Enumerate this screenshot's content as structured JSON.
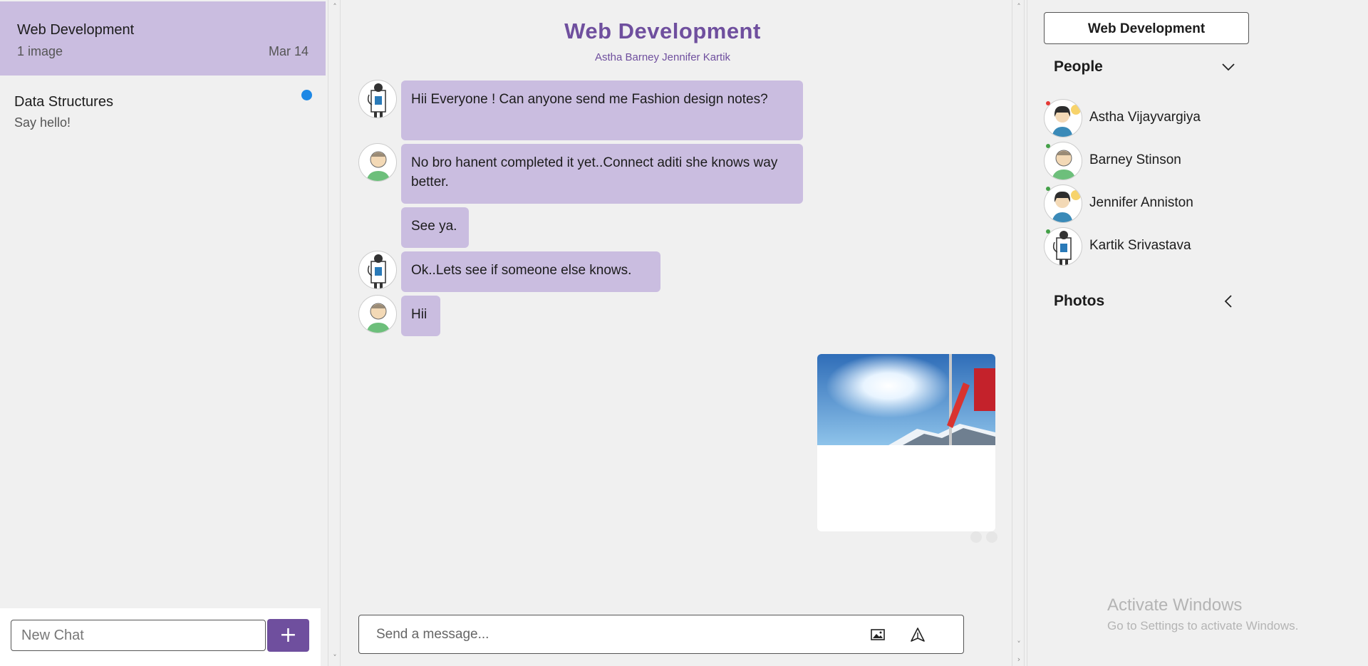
{
  "sidebar": {
    "chats": [
      {
        "title": "Web Development",
        "subtitle": "1 image",
        "date": "Mar 14"
      },
      {
        "title": "Data Structures",
        "subtitle": "Say hello!",
        "date": ""
      }
    ],
    "new_chat_placeholder": "New Chat",
    "add_label": "+"
  },
  "chat": {
    "title": "Web Development",
    "members": "Astha Barney Jennifer Kartik",
    "messages": [
      {
        "text": "Hii Everyone ! Can anyone send me Fashion design notes?",
        "avatar": "doctor-avatar"
      },
      {
        "text": "No bro hanent completed it yet..Connect aditi she knows way better.",
        "avatar": "man-avatar"
      },
      {
        "text": "See ya.",
        "avatar": ""
      },
      {
        "text": "Ok..Lets see if someone else knows.",
        "avatar": "doctor-avatar"
      },
      {
        "text": "Hii",
        "avatar": "man-avatar"
      }
    ],
    "message_placeholder": "Send a message..."
  },
  "details": {
    "title_button": "Web Development",
    "people_heading": "People",
    "photos_heading": "Photos",
    "people": [
      {
        "name": "Astha Vijayvargiya",
        "status_color": "#e53935",
        "avatar": "woman-avatar"
      },
      {
        "name": "Barney Stinson",
        "status_color": "#43a047",
        "avatar": "man-avatar"
      },
      {
        "name": "Jennifer Anniston",
        "status_color": "#43a047",
        "avatar": "woman-avatar"
      },
      {
        "name": "Kartik Srivastava",
        "status_color": "#43a047",
        "avatar": "doctor-avatar"
      }
    ]
  },
  "watermark": {
    "title": "Activate Windows",
    "subtitle": "Go to Settings to activate Windows."
  },
  "colors": {
    "accent": "#6f4f9e",
    "bubble": "#cabde0",
    "unread": "#1e88e5"
  }
}
